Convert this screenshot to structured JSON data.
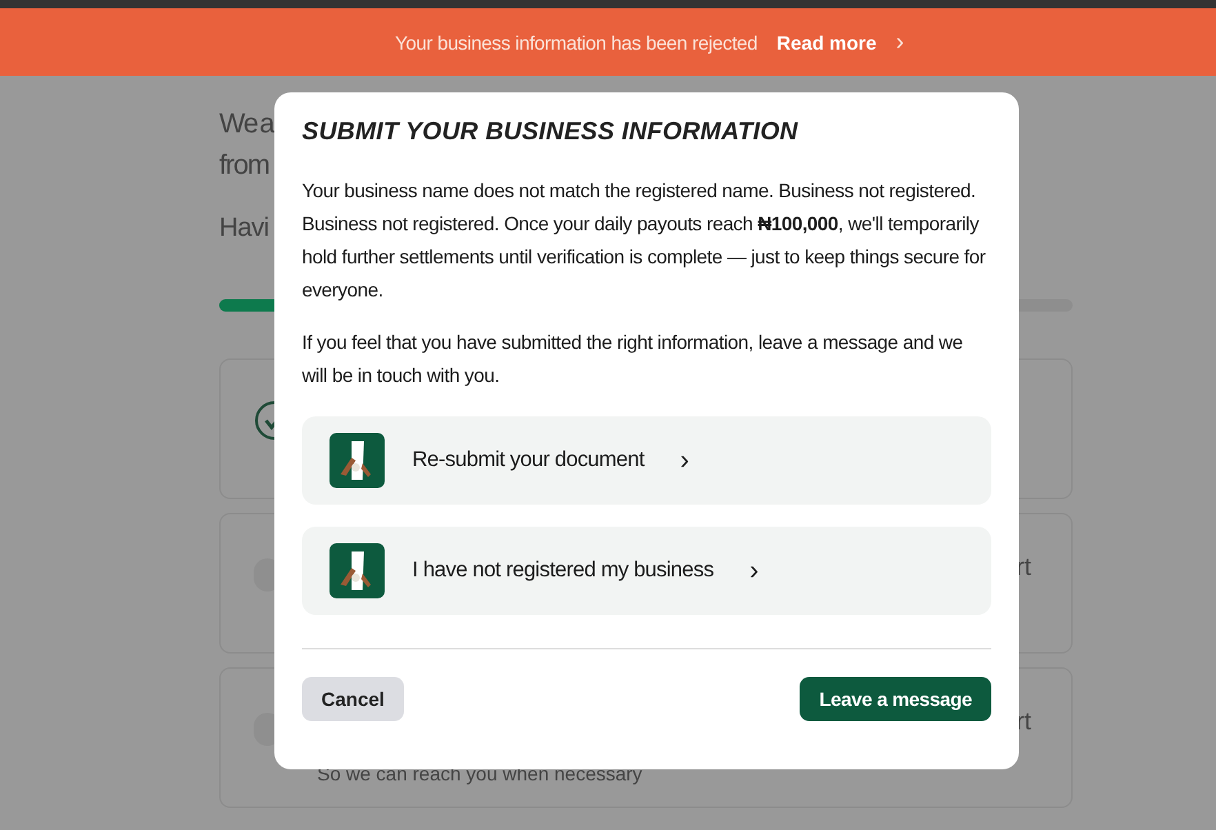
{
  "banner": {
    "message": "Your business information has been rejected",
    "link": "Read more",
    "chevron": "›"
  },
  "page": {
    "intro_lines": [
      "We a",
      "from"
    ],
    "subheading": "Havi",
    "progress": {
      "level": 0.3
    },
    "cards": [
      {
        "kind": "done"
      },
      {
        "kind": "pending",
        "tail": "rt"
      },
      {
        "kind": "pending",
        "tail": "rt",
        "note": "So we can reach you when necessary"
      }
    ]
  },
  "dialog": {
    "title": "SUBMIT YOUR BUSINESS INFORMATION",
    "paragraphs": [
      "Your business name does not match the registered name. Business not registered. Business not registered. Once your daily payouts reach **₦100,000**, we'll temporarily hold further settlements until verification is complete — just to keep things secure for everyone.",
      "If you feel that you have submitted the right information, leave a message and we will be in touch with you."
    ],
    "options": [
      {
        "label": "Re-submit your document",
        "chevron": "›"
      },
      {
        "label": "I have not registered my business",
        "chevron": "›"
      }
    ],
    "cancel": "Cancel",
    "confirm": "Leave a message"
  }
}
